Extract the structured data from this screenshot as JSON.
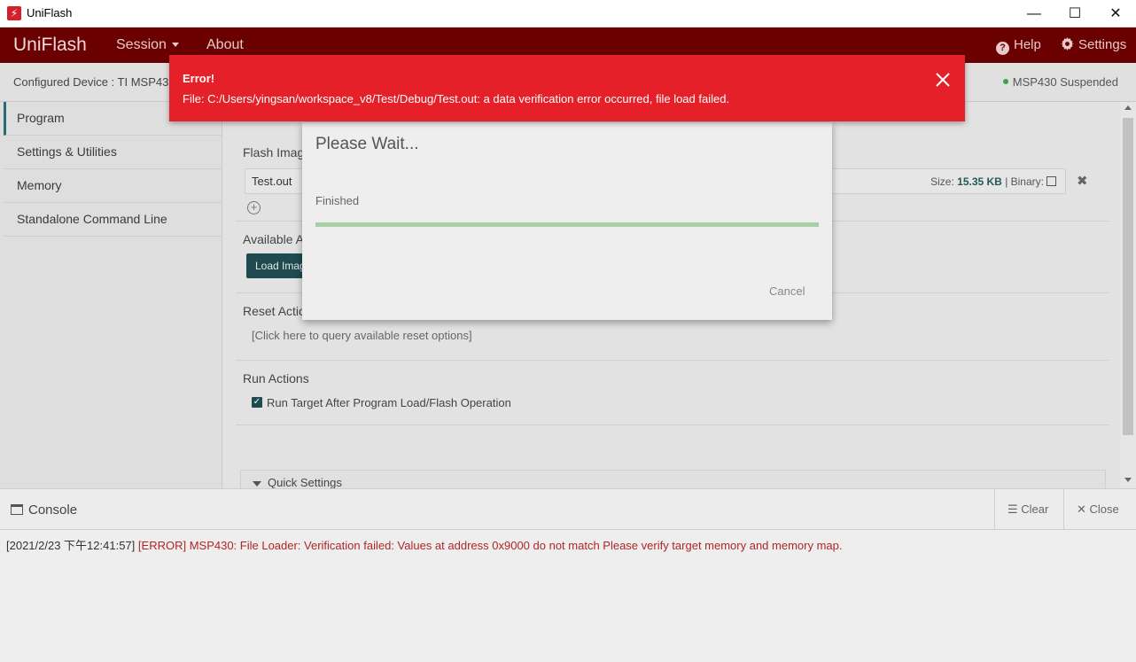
{
  "window": {
    "title": "UniFlash",
    "app_icon_glyph": "⚡",
    "minimize": "—",
    "maximize": "☐",
    "close": "✕"
  },
  "header": {
    "brand": "UniFlash",
    "menu_session": "Session",
    "menu_about": "About",
    "help_label": "Help",
    "settings_label": "Settings",
    "bg_color": "#6b0000"
  },
  "device": {
    "configured_label": "Configured Device : TI MSP43",
    "status": "MSP430 Suspended"
  },
  "sidebar": {
    "items": [
      {
        "label": "Program"
      },
      {
        "label": "Settings & Utilities"
      },
      {
        "label": "Memory"
      },
      {
        "label": "Standalone Command Line"
      }
    ]
  },
  "program": {
    "flash_image_label": "Flash Imag",
    "file_name": "Test.out",
    "size_label": "Size:",
    "size_value": "15.35 KB",
    "binary_label": "| Binary:",
    "remove_glyph": "✖",
    "add_glyph": "+",
    "available_actions_label": "Available A",
    "load_button": "Load Imag",
    "reset_actions_label": "Reset Actio",
    "reset_hint": "[Click here to query available reset options]",
    "run_actions_label": "Run Actions",
    "run_target_checked": true,
    "check_glyph": "✓",
    "run_target_label": "Run Target After Program Load/Flash Operation",
    "quick_settings_label": "Quick Settings"
  },
  "console": {
    "title": "Console",
    "clear_label": "Clear",
    "close_label": "Close",
    "log": [
      {
        "timestamp": "[2021/2/23 下午12:41:57]",
        "message": "[ERROR] MSP430: File Loader: Verification failed: Values at address 0x9000 do not match Please verify target memory and memory map."
      }
    ]
  },
  "modal": {
    "title": "Please Wait...",
    "status": "Finished",
    "progress": 1.0,
    "cancel_label": "Cancel"
  },
  "toast": {
    "title": "Error!",
    "message": "File: C:/Users/yingsan/workspace_v8/Test/Debug/Test.out: a data verification error occurred, file load failed.",
    "bg_color": "#e52028"
  }
}
